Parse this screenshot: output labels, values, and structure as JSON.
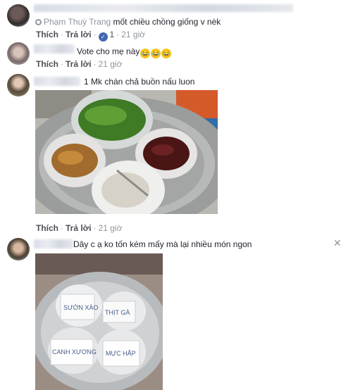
{
  "comments": [
    {
      "author": "Phạm Thuỳ Trang",
      "text": "mốt chiều chồng giống v nèk",
      "reply": "Thích",
      "respond": "Trả lời",
      "likes": "1",
      "time": "21 giờ"
    },
    {
      "text": "Vote cho mẹ này",
      "emoji": [
        "😂",
        "😂",
        "😂"
      ],
      "reply": "Thích",
      "respond": "Trả lời",
      "time": "21 giờ"
    },
    {
      "text": "1 Mk chán chả buồn nấu luon",
      "reply": "Thích",
      "respond": "Trả lời",
      "time": "21 giờ"
    },
    {
      "text": "Dây c ạ ko tốn kém mấy mà lại nhiều món ngon",
      "photo_labels": [
        "SƯỜN XÀO",
        "THỊT GÀ",
        "CANH XƯƠNG",
        "MỰC HẤP"
      ]
    }
  ],
  "icons": {
    "like": "like-icon",
    "close": "close-icon",
    "gear": "gear-icon"
  },
  "colors": {
    "link": "#4b4f56",
    "meta": "#90949c",
    "like_blue": "#4267b2"
  }
}
